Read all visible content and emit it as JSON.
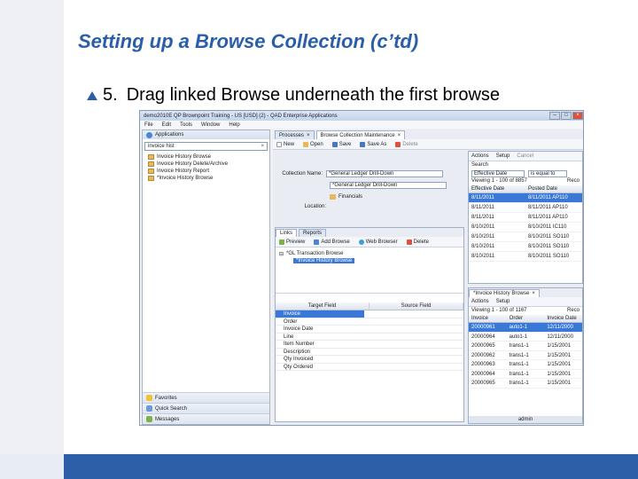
{
  "slide": {
    "title": "Setting up a Browse Collection (c’td)",
    "step_number": "5.",
    "step_text": "Drag linked Browse underneath the first browse"
  },
  "colors": {
    "title": "#2a5ea8",
    "bottom_bar": "#2d5fa8",
    "selection": "#3a78d8"
  },
  "screenshot": {
    "window_title": "demo2010E QP Brownpoint Training - US [USD] (2) - QAD Enterprise Applications",
    "menu": [
      "File",
      "Edit",
      "Tools",
      "Window",
      "Help"
    ],
    "sidebar": {
      "header": "Applications",
      "search_value": "invoice hist",
      "items": [
        "Invoice History Browse",
        "Invoice History Delete/Archive",
        "Invoice History Report",
        "*Invoice History Browse"
      ],
      "bottom": [
        "Favorites",
        "Quick Search",
        "Messages"
      ]
    },
    "tabs": [
      "Processes",
      "Browse Collection Maintenance"
    ],
    "toolbar": [
      "New",
      "Open",
      "Save",
      "Save As",
      "Delete"
    ],
    "form": {
      "collection_name_label": "Collection Name:",
      "collection_name_value": "*General Ledger Drill-Down",
      "description_value": "*General Ledger Drill-Down",
      "folder_label": "Financials",
      "location_label": "Location:"
    },
    "subtabs": [
      "Links",
      "Reports"
    ],
    "links_toolbar": [
      "Preview",
      "Add Browse",
      "Web Browser",
      "Delete"
    ],
    "tree": {
      "root": "*GL Transaction Browse",
      "selected_child": "*Invoice History Browse"
    },
    "fields_grid": {
      "headers": [
        "Target Field",
        "Source Field"
      ],
      "rows": [
        "Invoice",
        "Order",
        "Invoice Date",
        "Line",
        "Item Number",
        "Description",
        "Qty Invoiced",
        "Qty Ordered"
      ]
    },
    "right_top": {
      "toolbar": [
        "Actions",
        "Setup",
        "Cancel"
      ],
      "search_label": "Search",
      "filter_field": "Effective Date",
      "filter_op": "is equal to",
      "viewing": "Viewing 1 - 100 of 8857",
      "more": "Reco",
      "headers": [
        "Effective Date",
        "Posted Date"
      ],
      "rows": [
        [
          "8/11/2011",
          "8/11/2011 AP110"
        ],
        [
          "8/11/2011",
          "8/11/2011 AP110"
        ],
        [
          "8/11/2011",
          "8/11/2011 AP110"
        ],
        [
          "8/10/2011",
          "8/10/2011 IC110"
        ],
        [
          "8/10/2011",
          "8/10/2011 SO110"
        ],
        [
          "8/10/2011",
          "8/10/2011 SO110"
        ],
        [
          "8/10/2011",
          "8/10/2011 SO110"
        ]
      ]
    },
    "right_bottom": {
      "tab": "*Invoice History Browse",
      "toolbar": [
        "Actions",
        "Setup"
      ],
      "viewing": "Viewing 1 - 100 of 1167",
      "more": "Reco",
      "headers": [
        "Invoice",
        "Order",
        "Invoice Date"
      ],
      "rows": [
        [
          "20000961",
          "auto1-1",
          "12/11/2000"
        ],
        [
          "20000964",
          "auto1-1",
          "12/11/2000"
        ],
        [
          "20000965",
          "trans1-1",
          "1/15/2001"
        ],
        [
          "20000962",
          "trans1-1",
          "1/15/2001"
        ],
        [
          "20000963",
          "trans1-1",
          "1/15/2001"
        ],
        [
          "20000964",
          "trans1-1",
          "1/15/2001"
        ],
        [
          "20000965",
          "trans1-1",
          "1/15/2001"
        ]
      ],
      "status": "admin"
    }
  }
}
